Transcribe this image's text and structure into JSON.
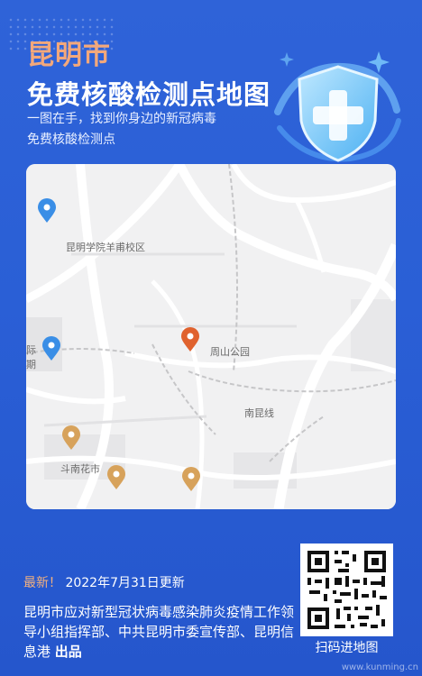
{
  "header": {
    "city": "昆明市",
    "title": "免费核酸检测点地图",
    "subtitle_line1": "一图在手，找到你身边的新冠病毒",
    "subtitle_line2": "免费核酸检测点"
  },
  "map": {
    "labels": {
      "campus": "昆明学院羊甫校区",
      "park": "周山公园",
      "road": "南昆线",
      "huayuan": "斗南花市",
      "edge_ji": "际",
      "edge_qi": "期"
    },
    "pins": [
      {
        "name": "pin-blue-1",
        "color": "#3a8ee6"
      },
      {
        "name": "pin-blue-2",
        "color": "#3a8ee6"
      },
      {
        "name": "pin-orange-selected",
        "color": "#e0622e"
      },
      {
        "name": "pin-gold-1",
        "color": "#d7a25b"
      },
      {
        "name": "pin-gold-2",
        "color": "#d7a25b"
      },
      {
        "name": "pin-gold-3",
        "color": "#d7a25b"
      }
    ]
  },
  "footer": {
    "latest_label": "最新！",
    "update_text": "2022年7月31日更新",
    "org_text": "昆明市应对新型冠状病毒感染肺炎疫情工作领导小组指挥部、中共昆明市委宣传部、昆明信息港",
    "produced_label": "出品",
    "qr_caption": "扫码进地图"
  },
  "watermark": "www.kunming.cn",
  "colors": {
    "background": "#2a5fd6",
    "accent_orange": "#f3a87b",
    "card_bg": "#f2f2f3"
  }
}
